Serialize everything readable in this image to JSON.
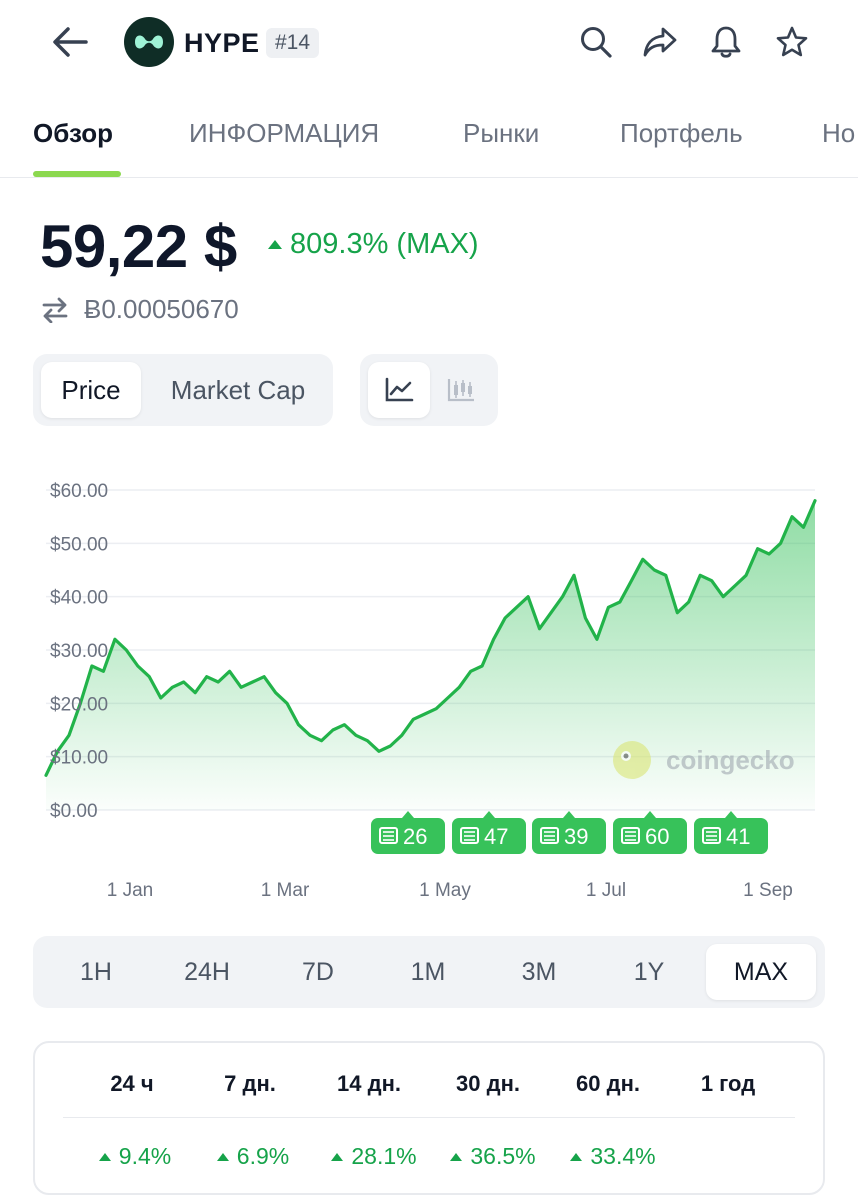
{
  "header": {
    "coin_symbol": "HYPE",
    "rank": "#14",
    "icons": [
      "back-arrow-icon",
      "search-icon",
      "share-icon",
      "bell-icon",
      "star-icon"
    ]
  },
  "tabs": [
    {
      "label": "Обзор",
      "active": true
    },
    {
      "label": "ИНФОРМАЦИЯ",
      "active": false
    },
    {
      "label": "Рынки",
      "active": false
    },
    {
      "label": "Портфель",
      "active": false
    },
    {
      "label": "Но",
      "active": false
    }
  ],
  "price": {
    "value": "59,22 $",
    "change": "809.3% (MAX)",
    "btc_value": "Ƀ0.00050670"
  },
  "chart_toggle": {
    "price_label": "Price",
    "market_cap_label": "Market Cap",
    "selected": "Price",
    "views": [
      "line-chart-icon",
      "candlestick-icon"
    ]
  },
  "watermark": "coingecko",
  "news_badges": [
    "26",
    "47",
    "39",
    "60",
    "41"
  ],
  "ranges": [
    {
      "label": "1H",
      "active": false
    },
    {
      "label": "24H",
      "active": false
    },
    {
      "label": "7D",
      "active": false
    },
    {
      "label": "1M",
      "active": false
    },
    {
      "label": "3M",
      "active": false
    },
    {
      "label": "1Y",
      "active": false
    },
    {
      "label": "MAX",
      "active": true
    }
  ],
  "performance": {
    "headers": [
      "24 ч",
      "7 дн.",
      "14 дн.",
      "30 дн.",
      "60 дн.",
      "1 год"
    ],
    "values": [
      "9.4%",
      "6.9%",
      "28.1%",
      "36.5%",
      "33.4%",
      ""
    ]
  },
  "colors": {
    "accent_green": "#16a34a",
    "line_green": "#22b34a",
    "tab_underline": "#8bd84f",
    "badge_green": "#37c25a"
  },
  "chart_data": {
    "type": "area",
    "title": "",
    "xlabel": "",
    "ylabel": "",
    "ylim": [
      0,
      60
    ],
    "y_ticks": [
      "$60.00",
      "$50.00",
      "$40.00",
      "$30.00",
      "$20.00",
      "$10.00",
      "$0.00"
    ],
    "x_ticks": [
      "1 Jan",
      "1 Mar",
      "1 May",
      "1 Jul",
      "1 Sep"
    ],
    "grid": true,
    "series": [
      {
        "values": [
          6.5,
          11,
          14,
          20,
          27,
          26,
          32,
          30,
          27,
          25,
          21,
          23,
          24,
          22,
          25,
          24,
          26,
          23,
          24,
          25,
          22,
          20,
          16,
          14,
          13,
          15,
          16,
          14,
          13,
          11,
          12,
          14,
          17,
          18,
          19,
          21,
          23,
          26,
          27,
          32,
          36,
          38,
          40,
          34,
          37,
          40,
          44,
          36,
          32,
          38,
          39,
          43,
          47,
          45,
          44,
          37,
          39,
          44,
          43,
          40,
          42,
          44,
          49,
          48,
          50,
          55,
          53,
          58
        ]
      }
    ]
  }
}
